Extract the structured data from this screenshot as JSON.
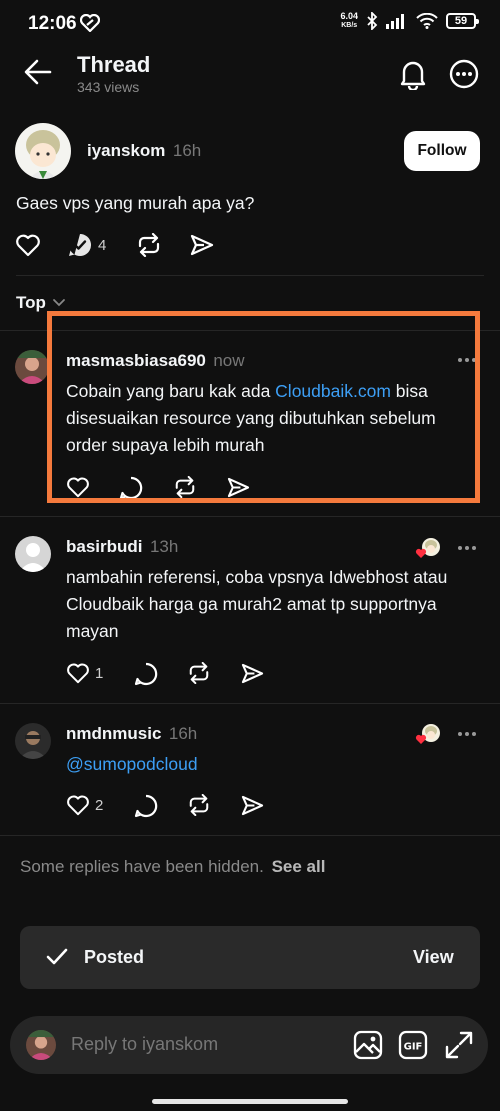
{
  "status_bar": {
    "time": "12:06",
    "net_speed_value": "6.04",
    "net_speed_unit": "KB/s",
    "battery": "59"
  },
  "header": {
    "title": "Thread",
    "views": "343 views"
  },
  "post": {
    "username": "iyanskom",
    "time": "16h",
    "follow_label": "Follow",
    "text": "Gaes vps yang murah apa ya?",
    "reply_count": "4"
  },
  "sort": {
    "label": "Top"
  },
  "replies": [
    {
      "username": "masmasbiasa690",
      "time": "now",
      "text_before": "Cobain yang baru kak ada ",
      "link": "Cloudbaik.com",
      "text_after": " bisa disesuaikan resource yang dibutuhkan sebelum order supaya lebih murah",
      "like_count": ""
    },
    {
      "username": "basirbudi",
      "time": "13h",
      "text": "nambahin referensi, coba vpsnya Idwebhost atau Cloudbaik harga ga murah2 amat tp supportnya mayan",
      "like_count": "1"
    },
    {
      "username": "nmdnmusic",
      "time": "16h",
      "mention": "@sumopodcloud",
      "like_count": "2"
    }
  ],
  "hidden_notice": {
    "text": "Some replies have been hidden.",
    "action": "See all"
  },
  "toast": {
    "label": "Posted",
    "action": "View"
  },
  "reply_bar": {
    "placeholder": "Reply to iyanskom"
  },
  "colors": {
    "background": "#101010",
    "highlight": "#f57a3d",
    "link": "#3d9ff5",
    "heart": "#ff3040"
  }
}
